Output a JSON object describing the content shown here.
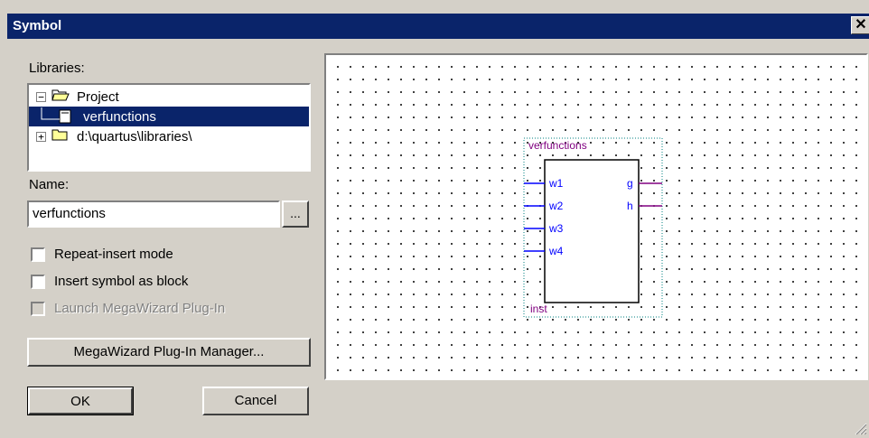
{
  "window": {
    "title": "Symbol",
    "close_glyph": "✕"
  },
  "libraries": {
    "label": "Libraries:",
    "items": [
      {
        "expander": "−",
        "icon": "open-folder-icon",
        "label": "Project"
      },
      {
        "icon": "symbol-file-icon",
        "label": "verfunctions",
        "selected": true
      },
      {
        "expander": "+",
        "icon": "folder-icon",
        "label": "d:\\quartus\\libraries\\"
      }
    ]
  },
  "name": {
    "label": "Name:",
    "value": "verfunctions",
    "browse_label": "..."
  },
  "options": {
    "repeat_insert": {
      "label": "Repeat-insert mode",
      "checked": false
    },
    "insert_block": {
      "label": "Insert symbol as block",
      "checked": false
    },
    "launch_megawizard": {
      "label": "Launch MegaWizard Plug-In",
      "checked": false,
      "disabled": true
    }
  },
  "buttons": {
    "megawizard": "MegaWizard Plug-In Manager...",
    "ok": "OK",
    "cancel": "Cancel"
  },
  "preview": {
    "symbol_name": "verfunctions",
    "instance": "inst",
    "inputs": [
      "w1",
      "w2",
      "w3",
      "w4"
    ],
    "outputs": [
      "g",
      "h"
    ],
    "colors": {
      "input_wire": "#0000ff",
      "output_wire": "#800080",
      "label": "#800080",
      "border": "#008080"
    }
  }
}
